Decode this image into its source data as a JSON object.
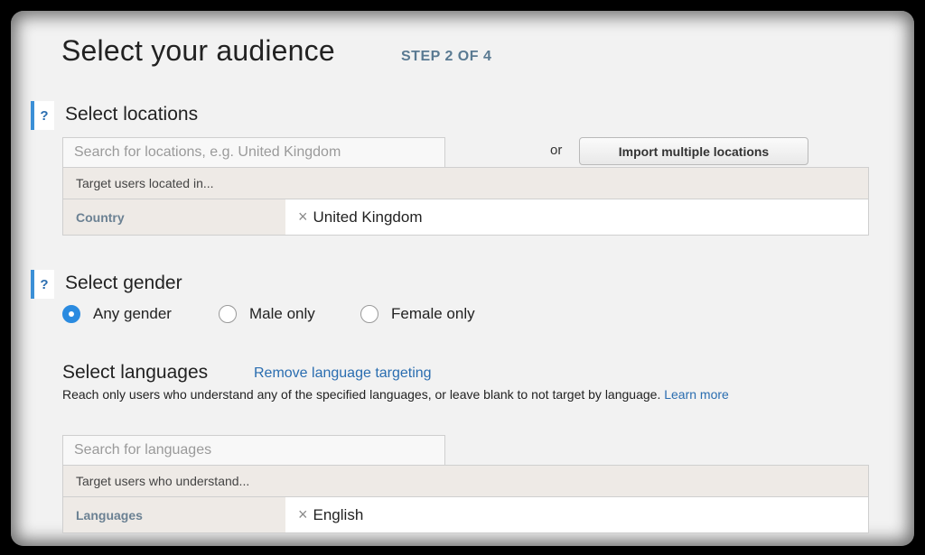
{
  "header": {
    "title": "Select your audience",
    "step": "STEP 2 OF 4"
  },
  "locations": {
    "help_icon": "?",
    "title": "Select locations",
    "search_placeholder": "Search for locations, e.g. United Kingdom",
    "or_label": "or",
    "import_button": "Import multiple locations",
    "target_header": "Target users located in...",
    "row_label": "Country",
    "value": "United Kingdom",
    "remove_icon": "×"
  },
  "gender": {
    "help_icon": "?",
    "title": "Select gender",
    "options": [
      "Any gender",
      "Male only",
      "Female only"
    ],
    "selected": "Any gender"
  },
  "languages": {
    "title": "Select languages",
    "remove_link": "Remove language targeting",
    "description": "Reach only users who understand any of the specified languages, or leave blank to not target by language.",
    "learn_more": "Learn more",
    "search_placeholder": "Search for languages",
    "target_header": "Target users who understand...",
    "row_label": "Languages",
    "value": "English",
    "remove_icon": "×"
  },
  "colors": {
    "accent": "#2b8be0",
    "link": "#2a6db0",
    "step": "#5a7a92"
  }
}
